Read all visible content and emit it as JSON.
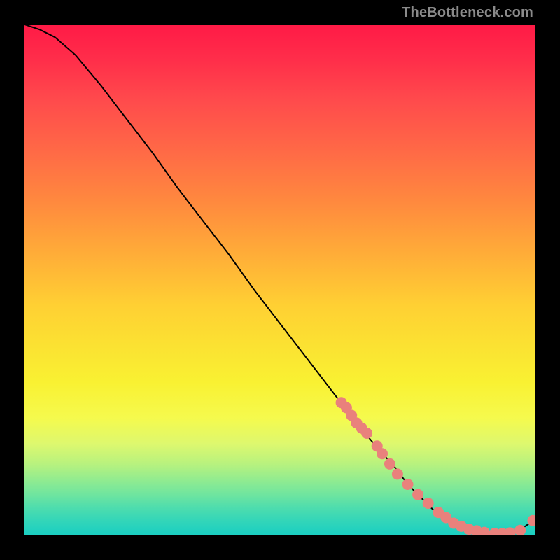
{
  "watermark": "TheBottleneck.com",
  "chart_data": {
    "type": "line",
    "title": "",
    "xlabel": "",
    "ylabel": "",
    "xlim": [
      0,
      100
    ],
    "ylim": [
      0,
      100
    ],
    "series": [
      {
        "name": "curve",
        "x": [
          0,
          3,
          6,
          10,
          15,
          20,
          25,
          30,
          35,
          40,
          45,
          50,
          55,
          60,
          65,
          70,
          72,
          75,
          78,
          80,
          82,
          84,
          86,
          88,
          90,
          92,
          94,
          96,
          98,
          100
        ],
        "values": [
          100,
          99,
          97.5,
          94,
          88,
          81.5,
          75,
          68,
          61.5,
          55,
          48,
          41.5,
          35,
          28.5,
          22,
          16,
          14,
          10,
          7,
          5,
          3.5,
          2.2,
          1.4,
          0.8,
          0.5,
          0.4,
          0.5,
          0.9,
          1.8,
          3.2
        ]
      }
    ],
    "markers": {
      "name": "dots",
      "color": "#e9817c",
      "x": [
        62,
        63,
        64,
        65,
        66,
        67,
        69,
        70,
        71.5,
        73,
        75,
        77,
        79,
        81,
        82.5,
        84,
        85.5,
        87,
        88.5,
        90,
        92,
        93.5,
        95,
        97,
        99.5
      ],
      "values": [
        26,
        25,
        23.5,
        22,
        21,
        20,
        17.5,
        16,
        14,
        12,
        10,
        8,
        6.3,
        4.5,
        3.5,
        2.4,
        1.8,
        1.2,
        0.9,
        0.6,
        0.4,
        0.4,
        0.5,
        1.0,
        2.9
      ]
    }
  }
}
